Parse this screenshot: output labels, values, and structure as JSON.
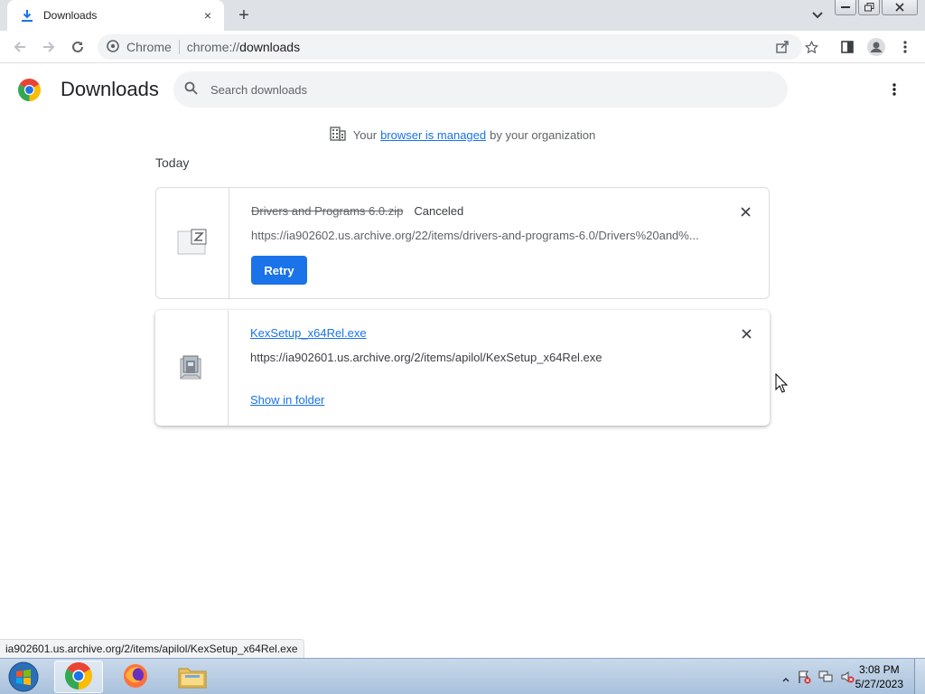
{
  "tab": {
    "title": "Downloads",
    "close_label": "×"
  },
  "newtab_label": "+",
  "omnibox": {
    "site_label": "Chrome",
    "url_scheme": "chrome://",
    "url_host": "downloads"
  },
  "page": {
    "title": "Downloads",
    "search_placeholder": "Search downloads",
    "managed_prefix": "Your",
    "managed_link": "browser is managed",
    "managed_suffix": "by your organization",
    "date_header": "Today"
  },
  "downloads": [
    {
      "filename": "Drivers and Programs 6.0.zip",
      "status": "Canceled",
      "url": "https://ia902602.us.archive.org/22/items/drivers-and-programs-6.0/Drivers%20and%...",
      "action_label": "Retry"
    },
    {
      "filename": "KexSetup_x64Rel.exe",
      "status": "",
      "url": "https://ia902601.us.archive.org/2/items/apilol/KexSetup_x64Rel.exe",
      "action_label": "Show in folder"
    }
  ],
  "status_bubble": "ia902601.us.archive.org/2/items/apilol/KexSetup_x64Rel.exe",
  "taskbar": {
    "time": "3:08 PM",
    "date": "5/27/2023"
  },
  "colors": {
    "accent": "#1a73e8",
    "tabstrip": "#dee1e6",
    "omnibox": "#f1f3f4"
  }
}
